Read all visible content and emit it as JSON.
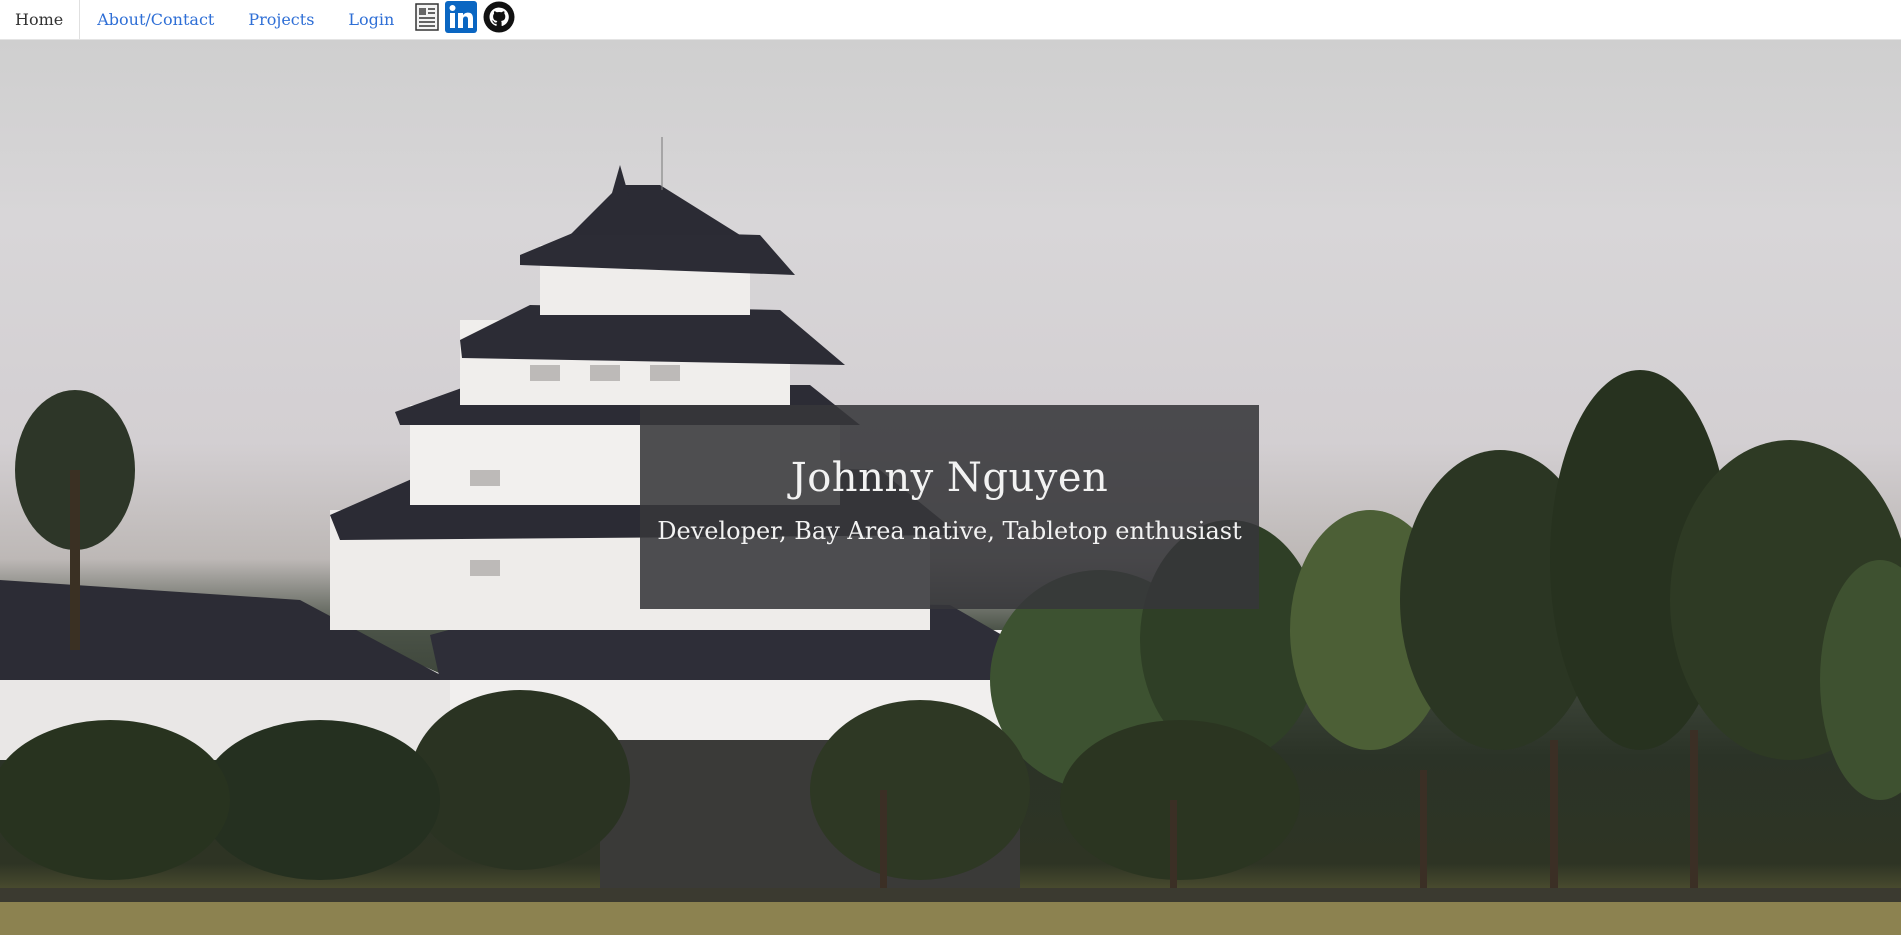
{
  "nav": {
    "items": [
      {
        "label": "Home",
        "active": true
      },
      {
        "label": "About/Contact",
        "active": false
      },
      {
        "label": "Projects",
        "active": false
      },
      {
        "label": "Login",
        "active": false
      }
    ],
    "icons": [
      "resume-icon",
      "linkedin-icon",
      "github-icon"
    ]
  },
  "hero": {
    "name": "Johnny Nguyen",
    "tagline": "Developer, Bay Area native, Tabletop enthusiast"
  },
  "colors": {
    "link": "#2f6fd6",
    "active_nav": "#333333",
    "linkedin_blue": "#0a66c2",
    "card_overlay": "#37373a"
  }
}
